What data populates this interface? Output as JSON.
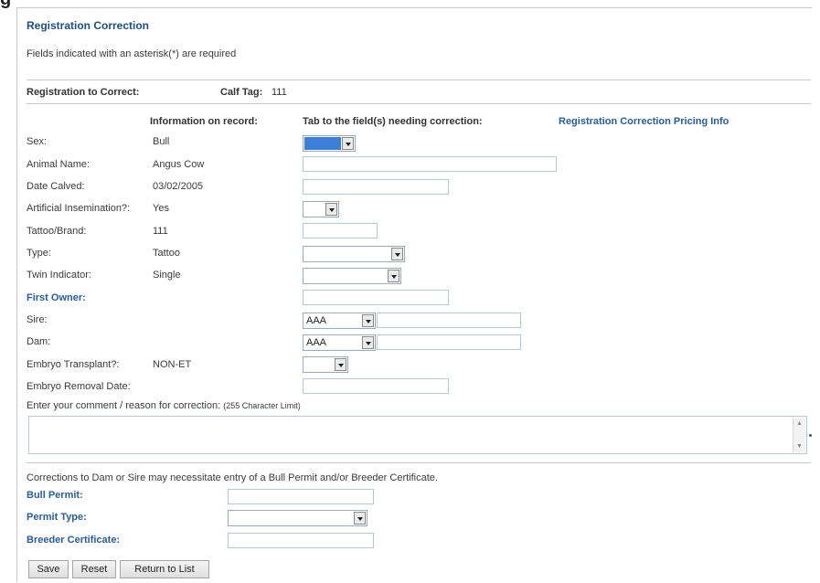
{
  "header": {
    "title": "Registration Correction",
    "required_note": "Fields indicated with an asterisk(*) are required"
  },
  "record": {
    "label": "Registration to Correct:",
    "calf_tag_label": "Calf Tag:",
    "calf_tag_value": "111"
  },
  "columns": {
    "info_on_record": "Information on record:",
    "tab_to_field": "Tab to the field(s) needing correction:",
    "pricing_link": "Registration Correction Pricing Info"
  },
  "rows": {
    "sex": {
      "label": "Sex:",
      "value": "Bull"
    },
    "animal_name": {
      "label": "Animal Name:",
      "value": "Angus Cow"
    },
    "date_calved": {
      "label": "Date Calved:",
      "value": "03/02/2005"
    },
    "ai": {
      "label": "Artificial Insemination?:",
      "value": "Yes"
    },
    "tattoo": {
      "label": "Tattoo/Brand:",
      "value": "111"
    },
    "type": {
      "label": "Type:",
      "value": "Tattoo"
    },
    "twin": {
      "label": "Twin Indicator:",
      "value": "Single"
    },
    "first_owner": {
      "label": "First Owner:"
    },
    "sire": {
      "label": "Sire:",
      "select_value": "AAA"
    },
    "dam": {
      "label": "Dam:",
      "select_value": "AAA"
    },
    "embryo": {
      "label": "Embryo Transplant?:",
      "value": "NON-ET"
    },
    "embryo_removal": {
      "label": "Embryo Removal Date:"
    }
  },
  "comment": {
    "label": "Enter your comment / reason for correction:",
    "limit": "(255 Character Limit)"
  },
  "permit": {
    "note": "Corrections to Dam or Sire may necessitate entry of a Bull Permit and/or Breeder Certificate.",
    "bull_permit": "Bull Permit:",
    "permit_type": "Permit Type:",
    "breeder_certificate": "Breeder Certificate:"
  },
  "buttons": {
    "save": "Save",
    "reset": "Reset",
    "return": "Return to List"
  },
  "frame_letter": "g",
  "colors": {
    "title": "#1f4f82",
    "link": "#2a5d9c",
    "selected": "#3d7fd6"
  }
}
